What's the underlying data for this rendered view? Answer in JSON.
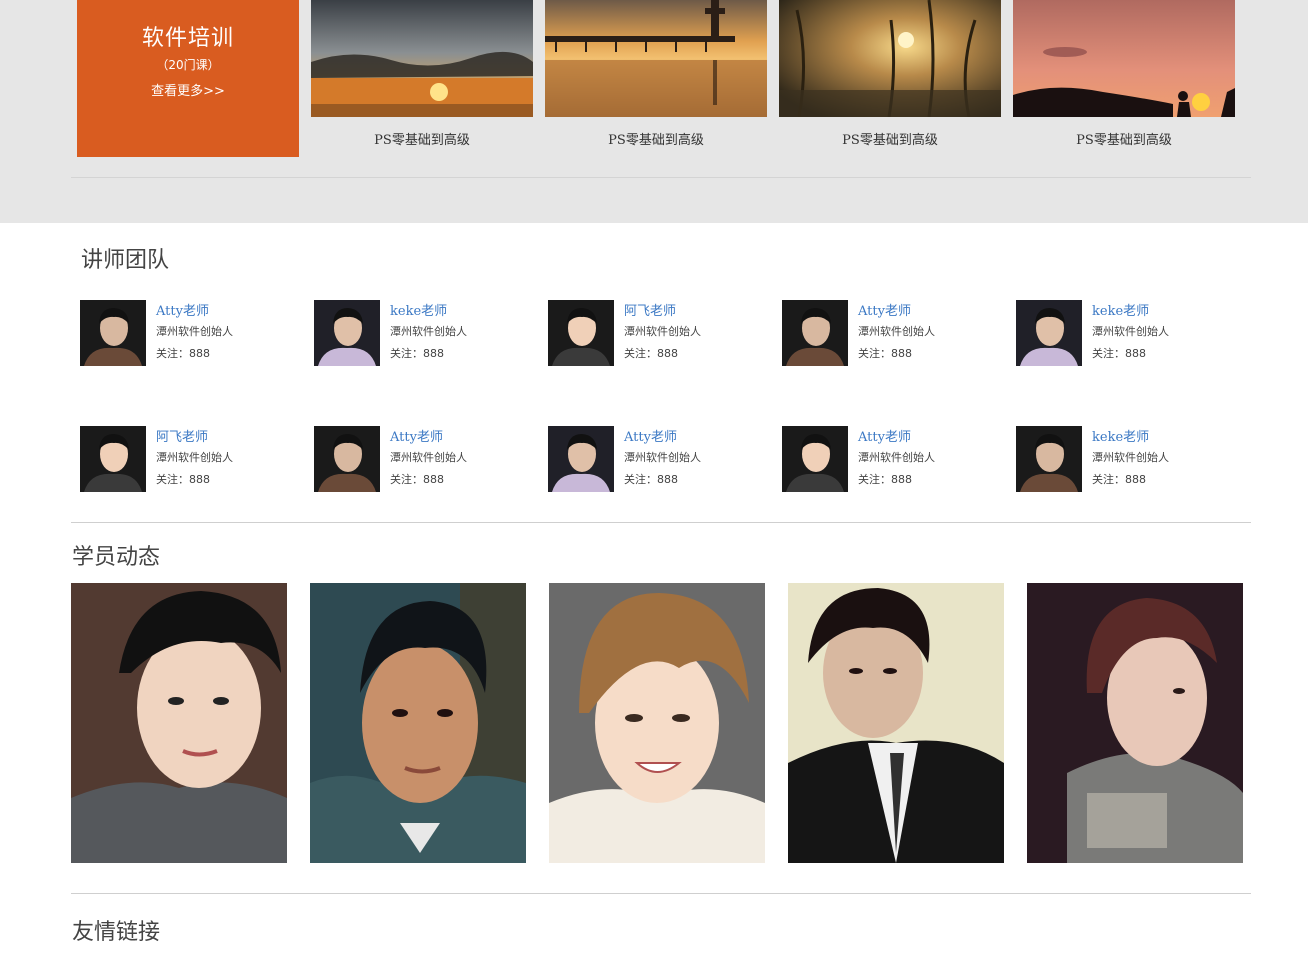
{
  "promo": {
    "title": "软件培训",
    "count": "（20门课）",
    "more": "查看更多>>",
    "color": "#d95c20"
  },
  "courses": [
    {
      "caption": "PS零基础到高级",
      "image": "sunset-clouds-photo"
    },
    {
      "caption": "PS零基础到高级",
      "image": "pier-sunset-photo"
    },
    {
      "caption": "PS零基础到高级",
      "image": "grass-sunset-photo"
    },
    {
      "caption": "PS零基础到高级",
      "image": "hill-silhouette-sunset-photo"
    }
  ],
  "teachers_section": {
    "title": "讲师团队",
    "teachers": [
      {
        "name": "Atty老师",
        "role": "潭州软件创始人",
        "follow": "关注：888"
      },
      {
        "name": "keke老师",
        "role": "潭州软件创始人",
        "follow": "关注：888"
      },
      {
        "name": "阿飞老师",
        "role": "潭州软件创始人",
        "follow": "关注：888"
      },
      {
        "name": "Atty老师",
        "role": "潭州软件创始人",
        "follow": "关注：888"
      },
      {
        "name": "keke老师",
        "role": "潭州软件创始人",
        "follow": "关注：888"
      },
      {
        "name": "阿飞老师",
        "role": "潭州软件创始人",
        "follow": "关注：888"
      },
      {
        "name": "Atty老师",
        "role": "潭州软件创始人",
        "follow": "关注：888"
      },
      {
        "name": "Atty老师",
        "role": "潭州软件创始人",
        "follow": "关注：888"
      },
      {
        "name": "Atty老师",
        "role": "潭州软件创始人",
        "follow": "关注：888"
      },
      {
        "name": "keke老师",
        "role": "潭州软件创始人",
        "follow": "关注：888"
      }
    ],
    "name_color": "#3b78c4"
  },
  "students_section": {
    "title": "学员动态",
    "photos": [
      "student-photo-1",
      "student-photo-2",
      "student-photo-3",
      "student-photo-4",
      "student-photo-5"
    ]
  },
  "links_section": {
    "title": "友情链接"
  }
}
